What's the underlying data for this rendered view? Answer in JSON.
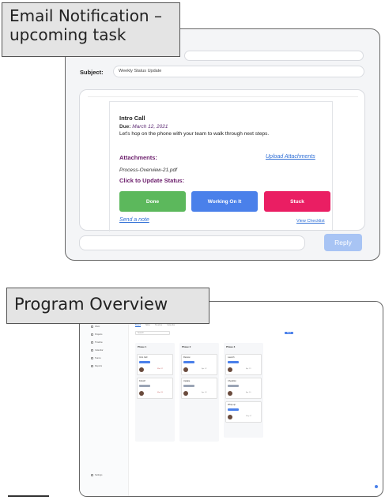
{
  "labels": {
    "email_line1": "Email Notification –",
    "email_line2": "upcoming task",
    "program": "Program Overview"
  },
  "email": {
    "subject_label": "Subject:",
    "subject_value": "Weekly Status Update",
    "task_title": "Intro Call",
    "due_label": "Due:",
    "due_date": "March 12, 2021",
    "description": "Let's hop on the phone with your team to walk through next steps.",
    "attachments_label": "Attachments:",
    "upload_link": "Upload Attachments",
    "attachment_file": "Process-Overview-21.pdf",
    "click_update_label": "Click to Update Status:",
    "status_buttons": [
      {
        "label": "Done",
        "color": "#5cb85c"
      },
      {
        "label": "Working On It",
        "color": "#4a80ea"
      },
      {
        "label": "Stuck",
        "color": "#ea1e63"
      }
    ],
    "send_note": "Send a note",
    "view_checklist": "View Checklist",
    "reply_button": "Reply"
  },
  "program": {
    "sidebar_items": [
      "Inbox",
      "Projects",
      "Timeline",
      "Calendar",
      "Teams",
      "Reports"
    ],
    "sidebar_bottom": "Settings",
    "tabs": [
      "Board",
      "Table",
      "Timeline",
      "Calendar"
    ],
    "search_placeholder": "Search",
    "toolbar_action": "New",
    "columns": [
      {
        "title": "Phase 1",
        "cards": [
          {
            "title": "Intro Call",
            "meta": "Mar 12"
          },
          {
            "title": "Kickoff",
            "meta": "Mar 19"
          }
        ]
      },
      {
        "title": "Phase 2",
        "cards": [
          {
            "title": "Review",
            "meta": "Apr 02"
          },
          {
            "title": "Update",
            "meta": "Apr 09"
          }
        ]
      },
      {
        "title": "Phase 3",
        "cards": [
          {
            "title": "Launch",
            "meta": "Apr 23"
          },
          {
            "title": "Checklist",
            "meta": "Apr 30"
          },
          {
            "title": "Wrap-up",
            "meta": "May 07"
          }
        ]
      }
    ]
  },
  "colors": {
    "accent": "#4a80ea",
    "done": "#5cb85c",
    "stuck": "#ea1e63",
    "reply": "#a8c4f4",
    "heading_purple": "#6b1d6b"
  }
}
